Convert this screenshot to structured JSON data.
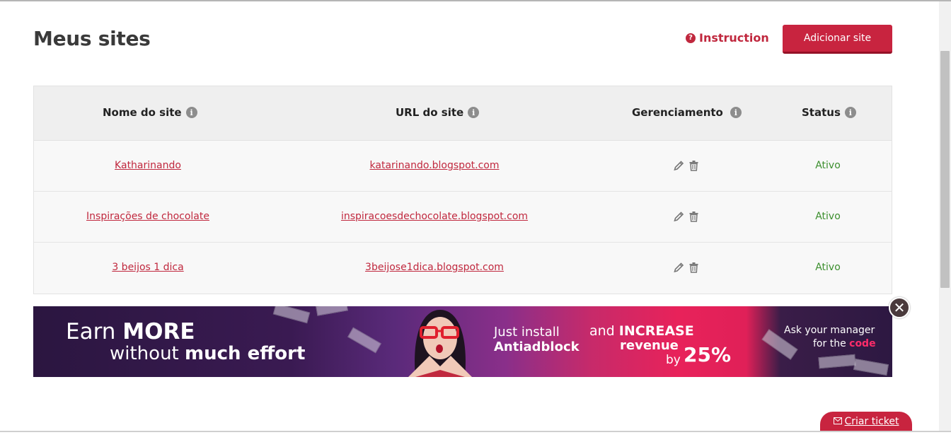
{
  "page": {
    "title": "Meus sites",
    "instruction_label": "Instruction",
    "add_site_label": "Adicionar site"
  },
  "table": {
    "headers": {
      "name": "Nome do site",
      "url": "URL do site",
      "management": "Gerenciamento",
      "status": "Status"
    },
    "rows": [
      {
        "name": "Katharinando",
        "url": "katarinando.blogspot.com",
        "status": "Ativo"
      },
      {
        "name": "Inspirações de chocolate",
        "url": "inspiracoesdechocolate.blogspot.com",
        "status": "Ativo"
      },
      {
        "name": "3 beijos 1 dica",
        "url": "3beijose1dica.blogspot.com",
        "status": "Ativo"
      }
    ]
  },
  "banner": {
    "earn": "Earn ",
    "earn_bold": "MORE",
    "without": "without ",
    "without_bold": "much effort",
    "just_install": "Just install",
    "antiadblock": "Antiadblock",
    "and": "and ",
    "increase": "INCREASE",
    "revenue": "revenue",
    "by": "by",
    "percent": "25%",
    "ask": "Ask your manager",
    "for_the": "for the ",
    "code": "code"
  },
  "footer": {
    "ticket_label": "Criar ticket"
  },
  "icons": {
    "help": "question-circle-icon",
    "info": "info-icon",
    "edit": "pencil-icon",
    "delete": "trash-icon",
    "close": "close-icon",
    "mail": "envelope-icon"
  },
  "colors": {
    "accent": "#c8243f",
    "status_active": "#3c8f2e"
  }
}
